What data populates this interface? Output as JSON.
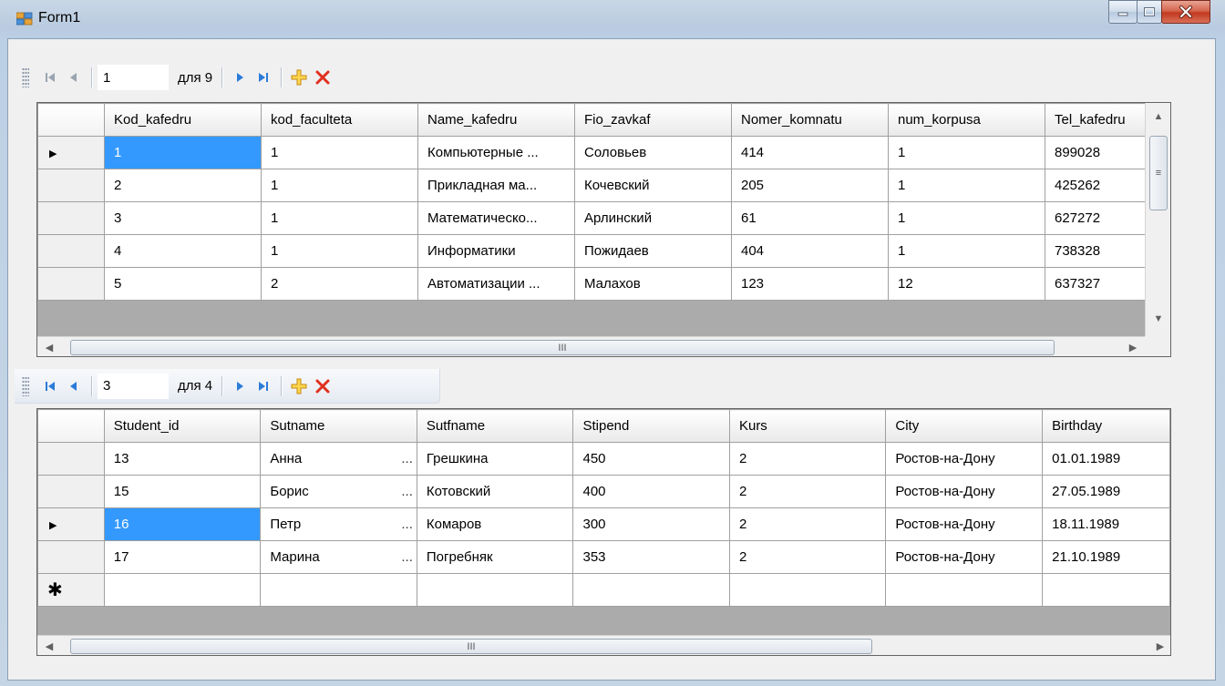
{
  "window": {
    "title": "Form1"
  },
  "navigator_top": {
    "position": "1",
    "of_label": "для 9"
  },
  "navigator_bottom": {
    "position": "3",
    "of_label": "для 4"
  },
  "grid_top": {
    "columns": [
      "Kod_kafedru",
      "kod_faculteta",
      "Name_kafedru",
      "Fio_zavkaf",
      "Nomer_komnatu",
      "num_korpusa",
      "Tel_kafedru"
    ],
    "rows": [
      [
        "1",
        "1",
        "Компьютерные ...",
        "Соловьев",
        "414",
        "1",
        "899028"
      ],
      [
        "2",
        "1",
        "Прикладная ма...",
        "Кочевский",
        "205",
        "1",
        "425262"
      ],
      [
        "3",
        "1",
        "Математическо...",
        "Арлинский",
        "61",
        "1",
        "627272"
      ],
      [
        "4",
        "1",
        "Информатики",
        "Пожидаев",
        "404",
        "1",
        "738328"
      ],
      [
        "5",
        "2",
        "Автоматизации ...",
        "Малахов",
        "123",
        "12",
        "637327"
      ]
    ],
    "current_row": 0,
    "scroll_mark": "III"
  },
  "grid_bottom": {
    "columns": [
      "Student_id",
      "Sutname",
      "Sutfname",
      "Stipend",
      "Kurs",
      "City",
      "Birthday"
    ],
    "rows": [
      [
        "13",
        "Анна",
        "Грешкина",
        "450",
        "2",
        "Ростов-на-Дону",
        "01.01.1989"
      ],
      [
        "15",
        "Борис",
        "Котовский",
        "400",
        "2",
        "Ростов-на-Дону",
        "27.05.1989"
      ],
      [
        "16",
        "Петр",
        "Комаров",
        "300",
        "2",
        "Ростов-на-Дону",
        "18.11.1989"
      ],
      [
        "17",
        "Марина",
        "Погребняк",
        "353",
        "2",
        "Ростов-на-Дону",
        "21.10.1989"
      ]
    ],
    "current_row": 2,
    "ellipsis": "...",
    "new_row_marker": "✱",
    "scroll_mark": "III"
  }
}
